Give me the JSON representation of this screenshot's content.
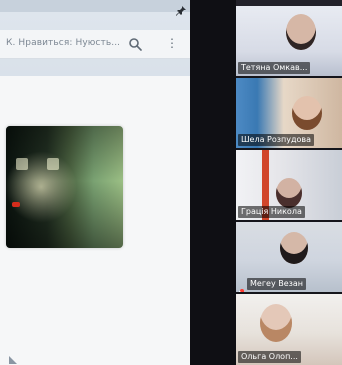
{
  "shared_screen": {
    "title_text": "К. Нравиться: Нуюсть...",
    "icons": {
      "pin": "pin-icon",
      "search": "search-icon",
      "more": "more-vertical-icon",
      "corner": "corner-icon"
    }
  },
  "participants": [
    {
      "name": "Тетяна Омкав..."
    },
    {
      "name": "Шела Розпудова"
    },
    {
      "name": "Грація Никола"
    },
    {
      "name": "Мегеу Везан"
    },
    {
      "name": "Ольга Олоп..."
    }
  ],
  "colors": {
    "background": "#1b1b22",
    "name_label_bg": "#000000",
    "accent_glow": "#3c6fe0"
  }
}
